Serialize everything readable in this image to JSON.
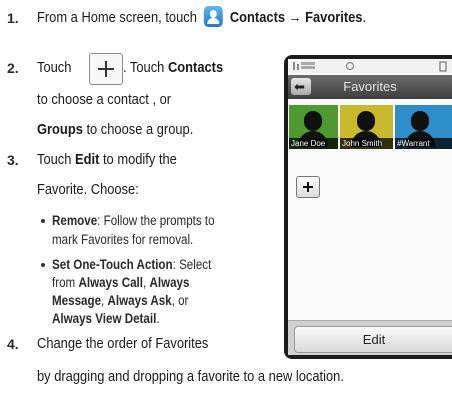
{
  "steps": {
    "s1": {
      "num": "1.",
      "pre": "From a Home screen, touch",
      "bold": "Contacts → Favorites",
      "post": "."
    },
    "s2": {
      "num": "2.",
      "pre": "Touch",
      "mid": ". Touch",
      "contacts": "Contacts",
      "l2": "to choose a contact , or",
      "groups": "Groups",
      "l3": " to choose a group."
    },
    "s3": {
      "num": "3.",
      "pre": "Touch",
      "edit": "Edit",
      "post": " to modify the",
      "l2": "Favorite. Choose:"
    },
    "b1": {
      "bold": "Remove",
      "text": ": Follow the prompts to",
      "l2": "mark Favorites for removal."
    },
    "b2": {
      "bold": "Set One-Touch Action",
      "text": ": Select",
      "l2a": "from ",
      "l2b": "Always Call",
      "l2c": ", ",
      "l2d": "Always",
      "l3a": "Message",
      "l3b": ", ",
      "l3c": "Always Ask",
      "l3d": ", or",
      "l4": "Always View Detail",
      "l4e": "."
    },
    "s4": {
      "num": "4.",
      "l1": "Change the order of Favorites",
      "l2": "by dragging and dropping a favorite to a new location."
    }
  },
  "phone": {
    "title": "Favorites",
    "back": "⬅",
    "contacts": [
      "Jane Doe",
      "John Smith",
      "#Warrant"
    ],
    "tile_colors": [
      "#4f9a2e",
      "#c9b92e",
      "#2e8ec9"
    ],
    "edit_label": "Edit"
  },
  "icons": {
    "contacts_app": "contacts-icon",
    "add": "plus-icon",
    "back": "back-arrow-icon"
  }
}
